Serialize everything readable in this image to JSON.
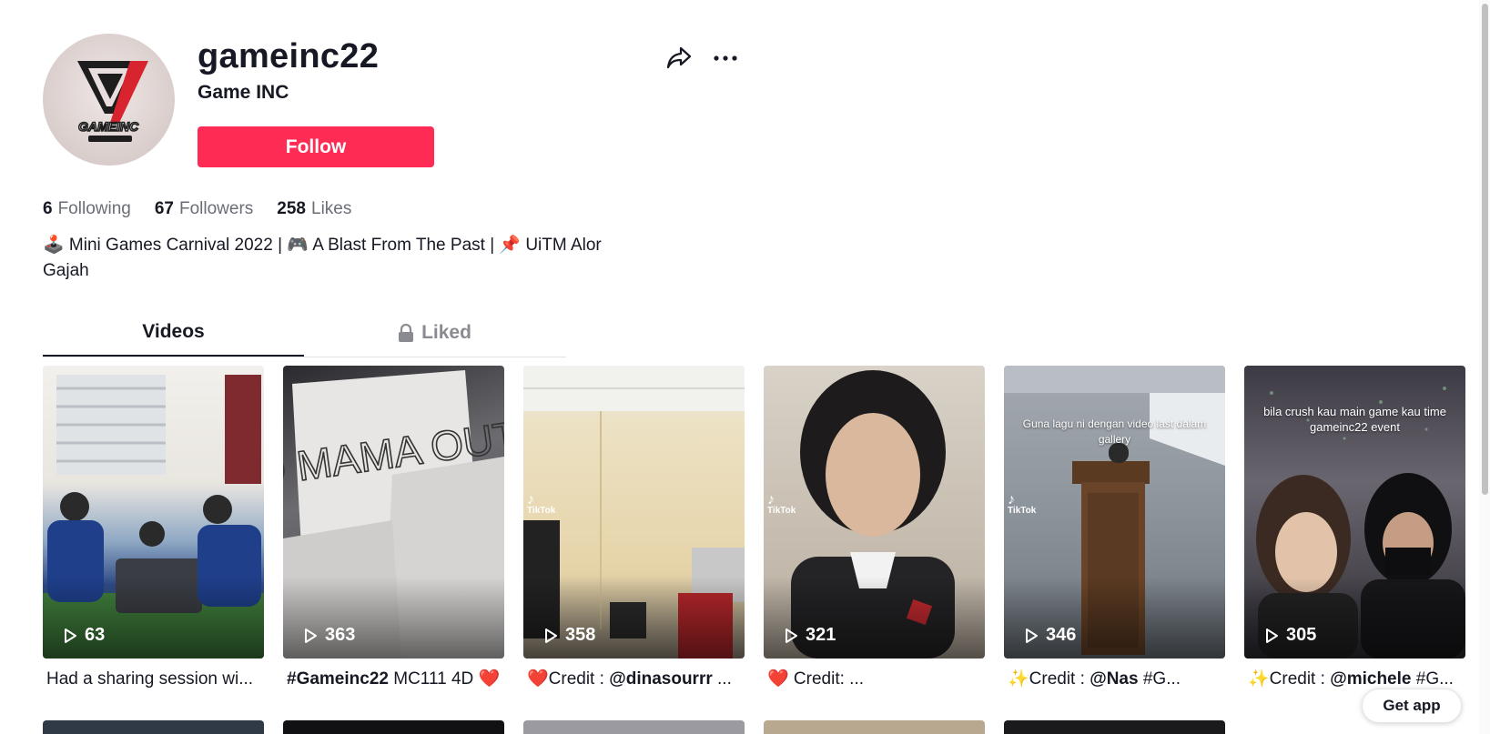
{
  "profile": {
    "username": "gameinc22",
    "nickname": "Game INC",
    "follow_label": "Follow",
    "stats": [
      {
        "num": "6",
        "label": "Following"
      },
      {
        "num": "67",
        "label": "Followers"
      },
      {
        "num": "258",
        "label": "Likes"
      }
    ],
    "bio": "🕹️ Mini Games Carnival 2022 | 🎮 A Blast From The Past | 📌 UiTM Alor Gajah",
    "avatar_text": "GAMEINC"
  },
  "icons": {
    "share": "share-icon",
    "more": "more-icon",
    "lock": "lock-icon",
    "play": "play-icon"
  },
  "colors": {
    "accent": "#fe2c55",
    "text": "#161823",
    "muted": "#6b6e76"
  },
  "tabs": [
    {
      "label": "Videos",
      "active": true
    },
    {
      "label": "Liked",
      "active": false,
      "locked": true
    }
  ],
  "videos": [
    {
      "plays": "63",
      "caption_plain": "Had a sharing session wi...",
      "caption_bold": "",
      "caption_rest": ""
    },
    {
      "plays": "363",
      "caption_plain": "",
      "caption_bold": "#Gameinc22",
      "caption_rest": " MC111 4D ❤️",
      "thumb_text": "YO MAMA OUT"
    },
    {
      "plays": "358",
      "caption_plain": "❤️Credit : ",
      "caption_bold": "@dinasourrr",
      "caption_rest": " ...",
      "badge": "TikTok"
    },
    {
      "plays": "321",
      "caption_plain": "❤️ Credit: ...",
      "caption_bold": "",
      "caption_rest": "",
      "badge": "TikTok"
    },
    {
      "plays": "346",
      "caption_plain": "✨Credit : ",
      "caption_bold": "@Nas",
      "caption_rest": " #G...",
      "badge": "TikTok",
      "overlay": "Guna lagu ni dengan video last dalam gallery"
    },
    {
      "plays": "305",
      "caption_plain": "✨Credit : ",
      "caption_bold": "@michele",
      "caption_rest": " #G...",
      "overlay": "bila crush kau main game kau time gameinc22 event"
    }
  ],
  "get_app_label": "Get app"
}
